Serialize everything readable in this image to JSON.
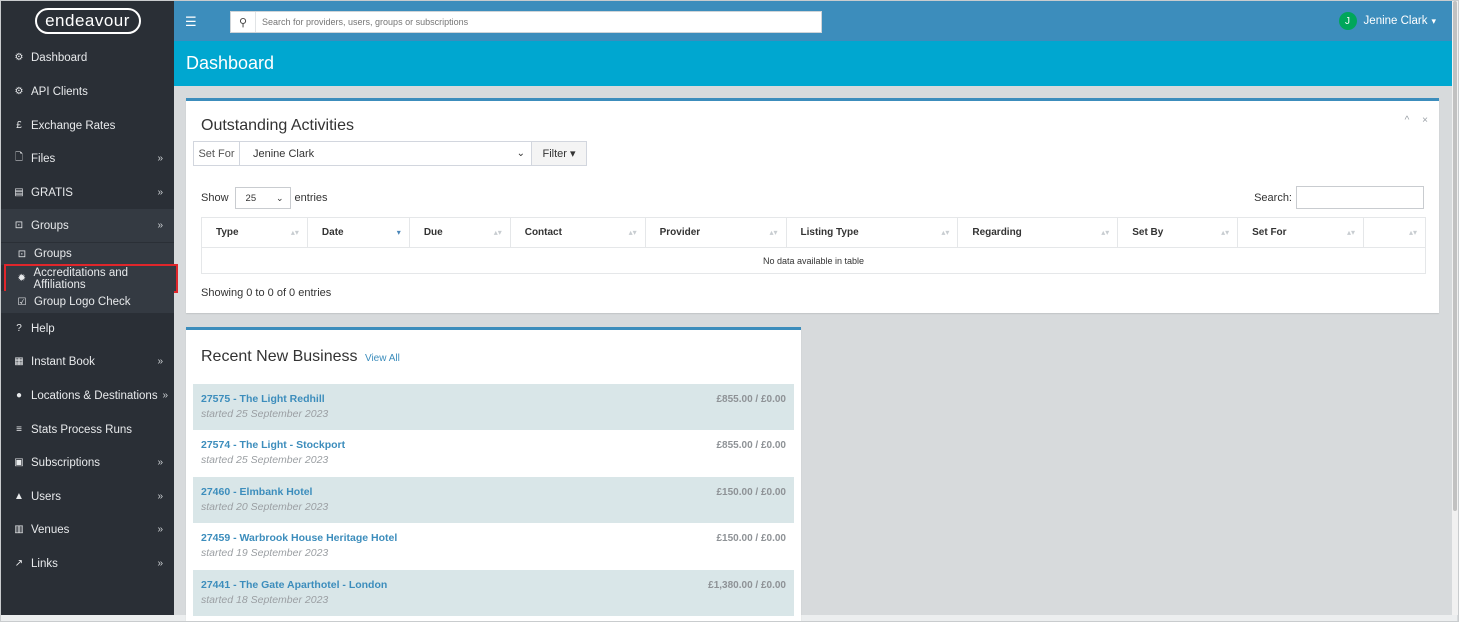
{
  "brand": {
    "logo_text": "endeavour"
  },
  "topbar": {
    "search_placeholder": "Search for providers, users, groups or subscriptions",
    "user_initial": "J",
    "user_name": "Jenine Clark",
    "user_caret": "▾"
  },
  "sidebar": {
    "items": [
      {
        "label": "Dashboard",
        "icon": "dashboard-icon",
        "glyph": "⚙"
      },
      {
        "label": "API Clients",
        "icon": "cogs-icon",
        "glyph": "⚙"
      },
      {
        "label": "Exchange Rates",
        "icon": "pound-icon",
        "glyph": "£"
      },
      {
        "label": "Files",
        "icon": "file-icon",
        "glyph": "🗋"
      },
      {
        "label": "GRATIS",
        "icon": "list-icon",
        "glyph": "▤"
      },
      {
        "label": "Groups",
        "icon": "group-icon",
        "glyph": "⊡"
      },
      {
        "label": "Help",
        "icon": "question-icon",
        "glyph": "?"
      },
      {
        "label": "Instant Book",
        "icon": "calendar-icon",
        "glyph": "▦"
      },
      {
        "label": "Locations & Destinations",
        "icon": "map-marker-icon",
        "glyph": "●"
      },
      {
        "label": "Stats Process Runs",
        "icon": "database-icon",
        "glyph": "≡"
      },
      {
        "label": "Subscriptions",
        "icon": "id-card-icon",
        "glyph": "▣"
      },
      {
        "label": "Users",
        "icon": "user-icon",
        "glyph": "▲"
      },
      {
        "label": "Venues",
        "icon": "building-icon",
        "glyph": "▥"
      },
      {
        "label": "Links",
        "icon": "external-link-icon",
        "glyph": "↗"
      }
    ],
    "chevron": "»",
    "groups_sub": [
      {
        "label": "Groups",
        "icon": "group-icon",
        "glyph": "⊡"
      },
      {
        "label": "Accreditations and Affiliations",
        "icon": "certificate-icon",
        "glyph": "✹"
      },
      {
        "label": "Group Logo Check",
        "icon": "check-square-icon",
        "glyph": "☑"
      }
    ]
  },
  "page": {
    "title": "Dashboard"
  },
  "outstanding": {
    "title": "Outstanding Activities",
    "tools": {
      "collapse": "^",
      "close": "×"
    },
    "set_for_label": "Set For",
    "set_for_value": "Jenine Clark",
    "filter_label": "Filter ▾",
    "show_label": "Show",
    "entries_value": "25",
    "entries_label": "entries",
    "search_label": "Search:",
    "columns": [
      "Type",
      "Date",
      "Due",
      "Contact",
      "Provider",
      "Listing Type",
      "Regarding",
      "Set By",
      "Set For",
      ""
    ],
    "empty_message": "No data available in table",
    "showing_text": "Showing 0 to 0 of 0 entries"
  },
  "recent_business": {
    "title": "Recent New Business",
    "view_all": "View All",
    "items": [
      {
        "name": "27575 - The Light Redhill",
        "date": "started 25 September 2023",
        "amount": "£855.00 / £0.00"
      },
      {
        "name": "27574 - The Light - Stockport",
        "date": "started 25 September 2023",
        "amount": "£855.00 / £0.00"
      },
      {
        "name": "27460 - Elmbank Hotel",
        "date": "started 20 September 2023",
        "amount": "£150.00 / £0.00"
      },
      {
        "name": "27459 - Warbrook House Heritage Hotel",
        "date": "started 19 September 2023",
        "amount": "£150.00 / £0.00"
      },
      {
        "name": "27441 - The Gate Aparthotel - London",
        "date": "started 18 September 2023",
        "amount": "£1,380.00 / £0.00"
      }
    ]
  },
  "colors": {
    "sidebar_bg": "#2a2f36",
    "topbar_bg": "#3c8dbc",
    "header_bg": "#00a7d0",
    "highlight_box": "#e0262b",
    "row_alt": "#d9e6e8"
  }
}
